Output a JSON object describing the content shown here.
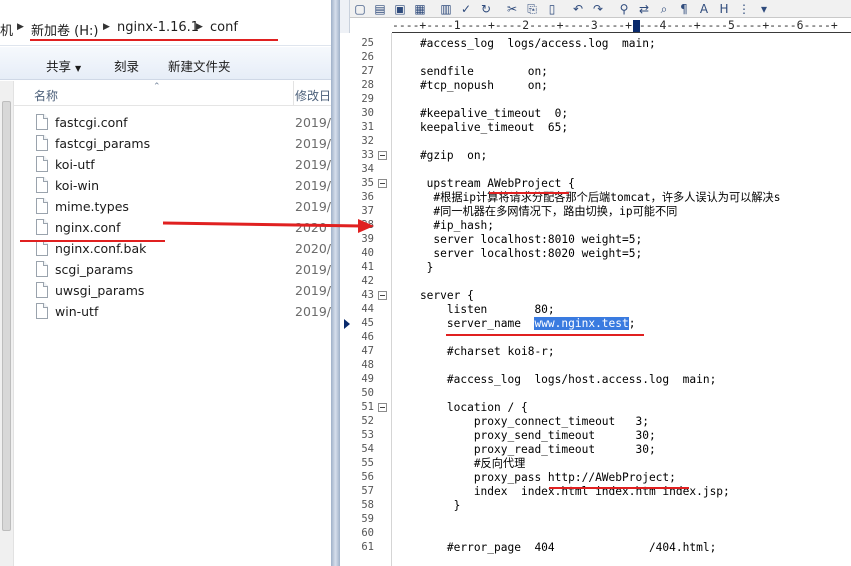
{
  "explorer": {
    "address": {
      "partial": "机",
      "crumbs": [
        "新加卷 (H:)",
        "nginx-1.16.1",
        "conf"
      ]
    },
    "toolbar": {
      "share": "共享",
      "burn": "刻录",
      "new_folder": "新建文件夹"
    },
    "columns": {
      "name": "名称",
      "modified": "修改日"
    },
    "files": [
      {
        "name": "fastcgi.conf",
        "date": "2019/"
      },
      {
        "name": "fastcgi_params",
        "date": "2019/"
      },
      {
        "name": "koi-utf",
        "date": "2019/"
      },
      {
        "name": "koi-win",
        "date": "2019/"
      },
      {
        "name": "mime.types",
        "date": "2019/"
      },
      {
        "name": "nginx.conf",
        "date": "2020"
      },
      {
        "name": "nginx.conf.bak",
        "date": "2020/"
      },
      {
        "name": "scgi_params",
        "date": "2019/"
      },
      {
        "name": "uwsgi_params",
        "date": "2019/"
      },
      {
        "name": "win-utf",
        "date": "2019/"
      }
    ]
  },
  "editor": {
    "ruler": "----+----1----+----2----+----3----+----4----+----5----+----6----+",
    "lines": [
      {
        "n": "25",
        "text": "    #access_log  logs/access.log  main;"
      },
      {
        "n": "26",
        "text": ""
      },
      {
        "n": "27",
        "text": "    sendfile        on;"
      },
      {
        "n": "28",
        "text": "    #tcp_nopush     on;"
      },
      {
        "n": "29",
        "text": ""
      },
      {
        "n": "30",
        "text": "    #keepalive_timeout  0;"
      },
      {
        "n": "31",
        "text": "    keepalive_timeout  65;"
      },
      {
        "n": "32",
        "text": ""
      },
      {
        "n": "33",
        "text": "    #gzip  on;"
      },
      {
        "n": "34",
        "text": ""
      },
      {
        "n": "35",
        "text": "     upstream AWebProject {"
      },
      {
        "n": "36",
        "text": "      #根据ip计算将请求分配各那个后端tomcat，许多人误认为可以解决s"
      },
      {
        "n": "37",
        "text": "      #同一机器在多网情况下，路由切换，ip可能不同"
      },
      {
        "n": "38",
        "text": "      #ip_hash;"
      },
      {
        "n": "39",
        "text": "      server localhost:8010 weight=5;"
      },
      {
        "n": "40",
        "text": "      server localhost:8020 weight=5;"
      },
      {
        "n": "41",
        "text": "     }"
      },
      {
        "n": "42",
        "text": ""
      },
      {
        "n": "43",
        "text": "    server {"
      },
      {
        "n": "44",
        "text": "        listen       80;"
      },
      {
        "n": "45",
        "text": "        server_name  ",
        "sel": "www.nginx.test",
        "after": ";"
      },
      {
        "n": "46",
        "text": ""
      },
      {
        "n": "47",
        "text": "        #charset koi8-r;"
      },
      {
        "n": "48",
        "text": ""
      },
      {
        "n": "49",
        "text": "        #access_log  logs/host.access.log  main;"
      },
      {
        "n": "50",
        "text": ""
      },
      {
        "n": "51",
        "text": "        location / {"
      },
      {
        "n": "52",
        "text": "            proxy_connect_timeout   3;"
      },
      {
        "n": "53",
        "text": "            proxy_send_timeout      30;"
      },
      {
        "n": "54",
        "text": "            proxy_read_timeout      30;"
      },
      {
        "n": "55",
        "text": "            #反向代理"
      },
      {
        "n": "56",
        "text": "            proxy_pass http://AWebProject;"
      },
      {
        "n": "57",
        "text": "            index  index.html index.htm index.jsp;"
      },
      {
        "n": "58",
        "text": "         }"
      },
      {
        "n": "59",
        "text": ""
      },
      {
        "n": "60",
        "text": ""
      },
      {
        "n": "61",
        "text": "        #error_page  404              /404.html;"
      }
    ]
  }
}
